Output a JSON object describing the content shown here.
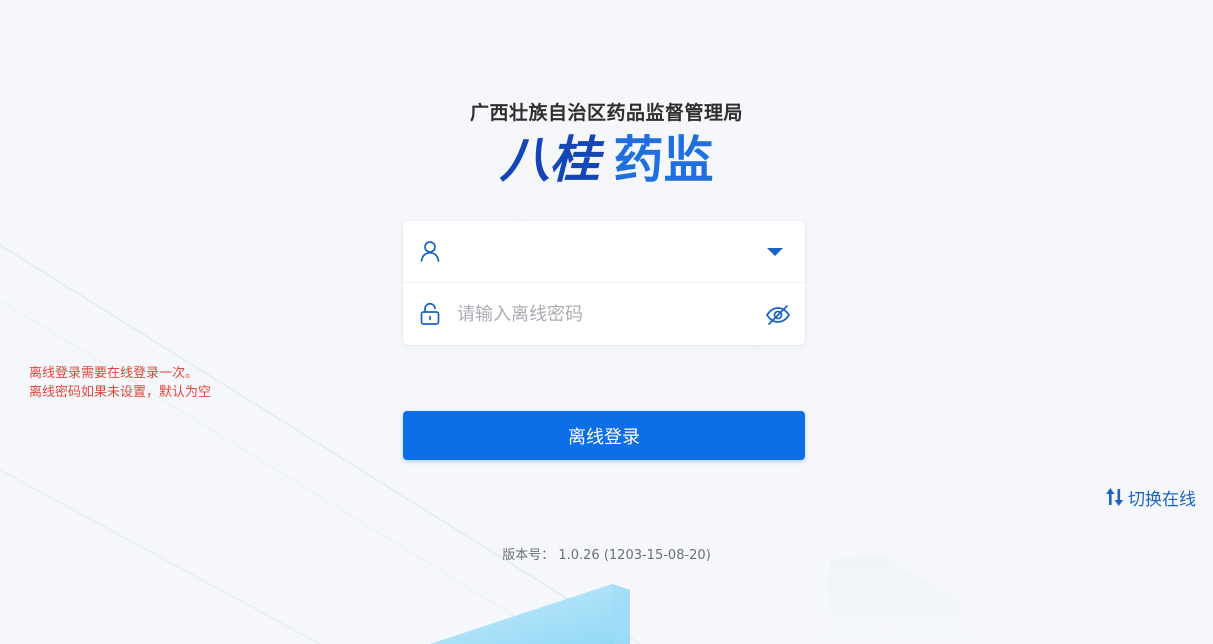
{
  "header": {
    "org_title": "广西壮族自治区药品监督管理局",
    "brand_part1": "八桂",
    "brand_part2": "药监"
  },
  "form": {
    "username": {
      "value": "",
      "placeholder": "",
      "icon": "user-icon",
      "dropdown_icon": "caret-down-icon"
    },
    "password": {
      "value": "",
      "placeholder": "请输入离线密码",
      "icon": "lock-icon",
      "toggle_icon": "eye-off-icon"
    }
  },
  "notice": {
    "line1": "离线登录需要在线登录一次。",
    "line2": "离线密码如果未设置，默认为空"
  },
  "login_button": {
    "label": "离线登录"
  },
  "switch_link": {
    "label": "切换在线",
    "icon": "switch-arrows-icon"
  },
  "version": {
    "label": "版本号：",
    "value": "1.0.26 (1203-15-08-20)"
  },
  "colors": {
    "primary": "#0d6fe8",
    "notice": "#e2463c",
    "link": "#1a63c7",
    "brand_dark": "#1446b8",
    "background": "#f5f7fa"
  }
}
